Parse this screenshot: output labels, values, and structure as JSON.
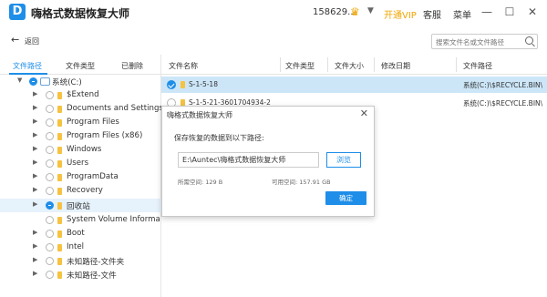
{
  "app": {
    "title": "嗨格式数据恢复大师",
    "logo_letter": "D"
  },
  "titlebar": {
    "user_id": "158629...",
    "vip_label": "开通VIP",
    "service_label": "客服",
    "menu_label": "菜单",
    "accent": "#1e8ee8",
    "vip_color": "#f0a500"
  },
  "toolbar": {
    "back_label": "返回",
    "search_placeholder": "搜索文件名或文件路径"
  },
  "left_panel": {
    "tabs": [
      "文件路径",
      "文件类型",
      "已删除"
    ],
    "drive_label": "系统(C:)",
    "tree_items": [
      "$Extend",
      "Documents and Settings",
      "Program Files",
      "Program Files (x86)",
      "Windows",
      "Users",
      "ProgramData",
      "Recovery",
      "回收站",
      "System Volume Informa",
      "Boot",
      "Intel",
      "未知路径-文件夹",
      "未知路径-文件"
    ]
  },
  "file_list": {
    "columns": [
      "文件名称",
      "文件类型",
      "文件大小",
      "修改日期",
      "文件路径"
    ],
    "rows": [
      {
        "name": "S-1-5-18",
        "path": "系统(C:)\\$RECYCLE.BIN\\"
      },
      {
        "name": "S-1-5-21-3601704934-2",
        "path": "系统(C:)\\$RECYCLE.BIN\\"
      }
    ]
  },
  "dialog": {
    "title": "嗨格式数据恢复大师",
    "prompt": "保存恢复的数据到以下路径:",
    "path_value": "E:\\Auntec\\嗨格式数据恢复大师",
    "browse_label": "浏览",
    "space_needed": "所需空间: 129 B",
    "space_available": "可用空间: 157.91 GB",
    "ok_label": "确定"
  }
}
